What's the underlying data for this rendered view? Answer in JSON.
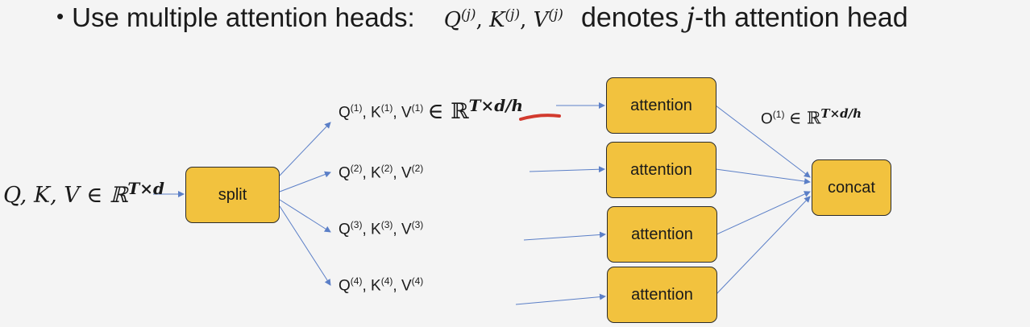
{
  "header": {
    "bullet": "•",
    "text": "Use multiple attention heads:",
    "qkv_math": "Q",
    "qkv_k": "K",
    "qkv_v": "V",
    "qkv_sup": "(j)",
    "denotes_pre": "denotes ",
    "denotes_j": "j",
    "denotes_post": "-th attention head"
  },
  "input_label": {
    "vars": "Q, K, V ∈ ℝ",
    "sup": "T×d"
  },
  "split_box": "split",
  "heads": [
    {
      "label": "Q",
      "k": "K",
      "v": "V",
      "idx": "(1)",
      "suffix": "∈ ℝ",
      "suffix_sup": "T×d/h"
    },
    {
      "label": "Q",
      "k": "K",
      "v": "V",
      "idx": "(2)"
    },
    {
      "label": "Q",
      "k": "K",
      "v": "V",
      "idx": "(3)"
    },
    {
      "label": "Q",
      "k": "K",
      "v": "V",
      "idx": "(4)"
    }
  ],
  "attention_boxes": [
    "attention",
    "attention",
    "attention",
    "attention"
  ],
  "output_label": {
    "o": "O",
    "idx": "(1)",
    "suffix": "∈ ℝ",
    "sup": "T×d/h"
  },
  "concat_box": "concat",
  "colors": {
    "box_fill": "#f2c23e",
    "arrow": "#5b7fc7",
    "annotation": "#d23a2e"
  }
}
